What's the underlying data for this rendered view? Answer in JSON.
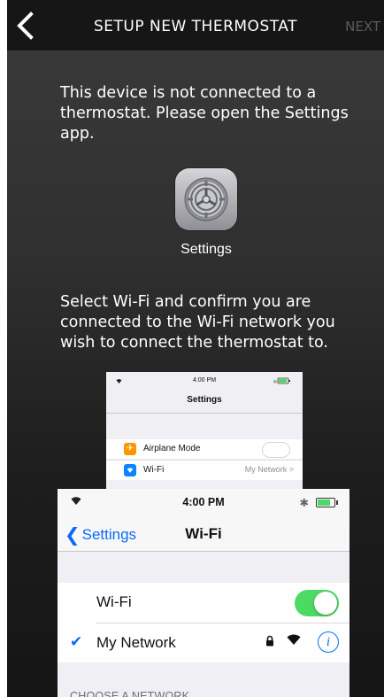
{
  "header": {
    "title": "SETUP NEW THERMOSTAT",
    "next_label": "NEXT"
  },
  "instructions": {
    "step1": "This device is not connected to a thermostat. Please open the Settings app.",
    "settings_app_label": "Settings",
    "step2": "Select Wi-Fi and confirm you are connected to the Wi-Fi network you wish to connect the thermostat to."
  },
  "small_screenshot": {
    "time": "4:00 PM",
    "title": "Settings",
    "rows": [
      {
        "label": "Airplane Mode",
        "icon": "airplane-icon",
        "color": "#ff9500"
      },
      {
        "label": "Wi-Fi",
        "value": "My Network",
        "icon": "wifi-icon",
        "color": "#0a84ff"
      }
    ]
  },
  "large_screenshot": {
    "time": "4:00 PM",
    "back_label": "Settings",
    "title": "Wi-Fi",
    "wifi_row_label": "Wi-Fi",
    "wifi_enabled": true,
    "network_name": "My Network",
    "section_header": "CHOOSE A NETWORK"
  },
  "colors": {
    "ios_blue": "#0a6cf5",
    "toggle_green": "#4cd964"
  }
}
